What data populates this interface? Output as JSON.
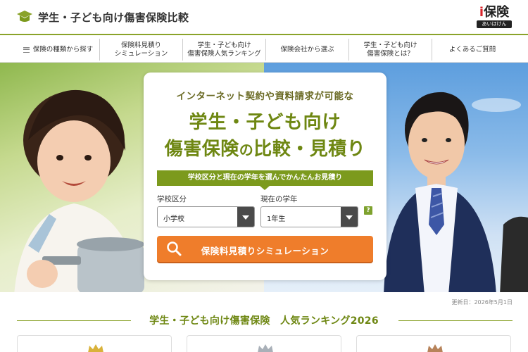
{
  "header": {
    "site_title": "学生・子ども向け傷害保険比較",
    "brand_logo": "i保険",
    "brand_sub": "あいほけん",
    "logo_icon": "mortarboard-icon",
    "accent": "#8aa32a"
  },
  "nav": {
    "items": [
      {
        "label": "保険の種類から探す",
        "icon": "menu-icon"
      },
      {
        "label": "保険料見積り\nシミュレーション"
      },
      {
        "label": "学生・子ども向け\n傷害保険人気ランキング"
      },
      {
        "label": "保険会社から選ぶ"
      },
      {
        "label": "学生・子ども向け\n傷害保険とは？"
      },
      {
        "label": "よくあるご質問"
      }
    ]
  },
  "hero": {
    "lead": "インターネット契約や資料請求が可能な",
    "title_line1": "学生・子ども向け",
    "title_line2_a": "傷害保険",
    "title_line2_b": "の",
    "title_line2_c": "比較・見積り",
    "band_text": "学校区分と現在の学年を選んでかんたんお見積り",
    "school_label": "学校区分",
    "school_value": "小学校",
    "grade_label": "現在の学年",
    "grade_value": "1年生",
    "help_label": "?",
    "cta_label": "保険料見積りシミュレーション",
    "cta_color": "#ef7d2b"
  },
  "updated": "更新日：2026年5月1日",
  "ranking": {
    "title": "学生・子ども向け傷害保険　人気ランキング2026",
    "cards": [
      {
        "crown": "gold-crown-icon",
        "color": "#d9b23a"
      },
      {
        "crown": "silver-crown-icon",
        "color": "#a9b0b8"
      },
      {
        "crown": "bronze-crown-icon",
        "color": "#b7835a"
      }
    ]
  }
}
